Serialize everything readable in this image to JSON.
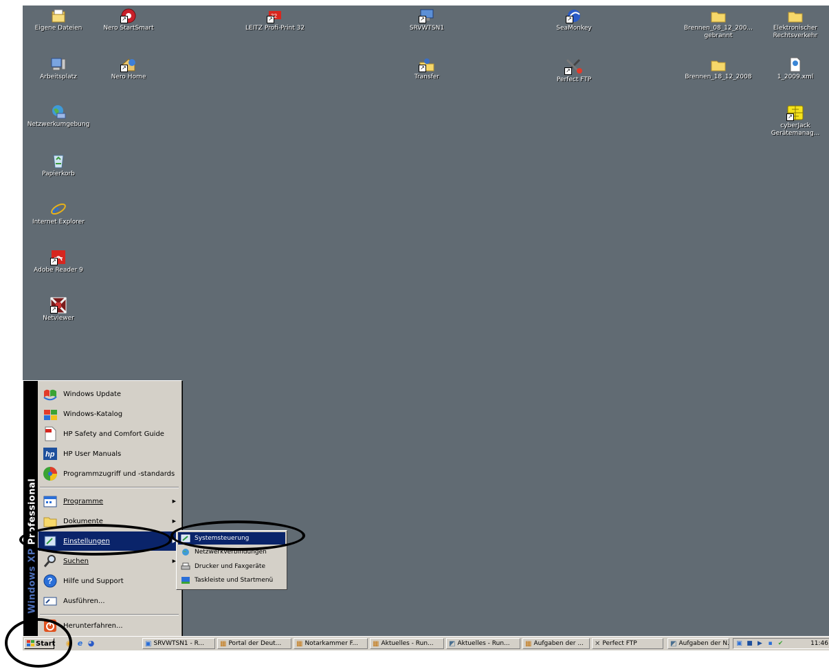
{
  "desktop": {
    "icons": [
      {
        "label": "Eigene Dateien",
        "icon": "my-documents-icon"
      },
      {
        "label": "Nero StartSmart",
        "icon": "nero-icon"
      },
      {
        "label": "LEITZ Profi-Print 32",
        "icon": "leitz-icon"
      },
      {
        "label": "SRVWTSN1",
        "icon": "remote-desktop-icon"
      },
      {
        "label": "SeaMonkey",
        "icon": "seamonkey-icon"
      },
      {
        "label": "Brennen_08_12_200... gebrannt",
        "icon": "folder-icon"
      },
      {
        "label": "Elektronischer Rechtsverkehr",
        "icon": "folder-icon"
      },
      {
        "label": "Arbeitsplatz",
        "icon": "my-computer-icon"
      },
      {
        "label": "Nero Home",
        "icon": "nero-home-icon"
      },
      {
        "label": "Transfer",
        "icon": "transfer-icon"
      },
      {
        "label": "Perfect FTP",
        "icon": "ftp-icon"
      },
      {
        "label": "Brennen_18_12_2008",
        "icon": "folder-icon"
      },
      {
        "label": "1_2009.xml",
        "icon": "xml-file-icon"
      },
      {
        "label": "Netzwerkumgebung",
        "icon": "network-icon"
      },
      {
        "label": "cyberJack Gerätemanag...",
        "icon": "chip-card-icon"
      },
      {
        "label": "Papierkorb",
        "icon": "recycle-bin-icon"
      },
      {
        "label": "Internet Explorer",
        "icon": "internet-explorer-icon"
      },
      {
        "label": "Adobe Reader 9",
        "icon": "adobe-reader-icon"
      },
      {
        "label": "Netviewer",
        "icon": "netviewer-icon"
      }
    ]
  },
  "start_menu": {
    "banner_bold": "Windows XP",
    "banner_rest": "Professional",
    "items": [
      {
        "label": "Windows Update"
      },
      {
        "label": "Windows-Katalog"
      },
      {
        "label": "HP Safety and Comfort Guide"
      },
      {
        "label": "HP User Manuals"
      },
      {
        "label": "Programmzugriff und -standards"
      },
      {
        "label": "Programme"
      },
      {
        "label": "Dokumente"
      },
      {
        "label": "Einstellungen"
      },
      {
        "label": "Suchen"
      },
      {
        "label": "Hilfe und Support"
      },
      {
        "label": "Ausführen..."
      },
      {
        "label": "Herunterfahren..."
      }
    ]
  },
  "settings_submenu": {
    "items": [
      {
        "label": "Systemsteuerung"
      },
      {
        "label": "Netzwerkverbindungen"
      },
      {
        "label": "Drucker und Faxgeräte"
      },
      {
        "label": "Taskleiste und Startmenü"
      }
    ]
  },
  "taskbar": {
    "start_label": "Start",
    "buttons": [
      {
        "label": "SRVWTSN1 - R..."
      },
      {
        "label": "Portal der Deut..."
      },
      {
        "label": "Notarkammer F..."
      },
      {
        "label": "Aktuelles - Run..."
      },
      {
        "label": "Aktuelles - Run..."
      },
      {
        "label": "Aufgaben der ..."
      },
      {
        "label": "Perfect FTP"
      },
      {
        "label": "Aufgaben der N..."
      }
    ],
    "clock": "11:46"
  }
}
